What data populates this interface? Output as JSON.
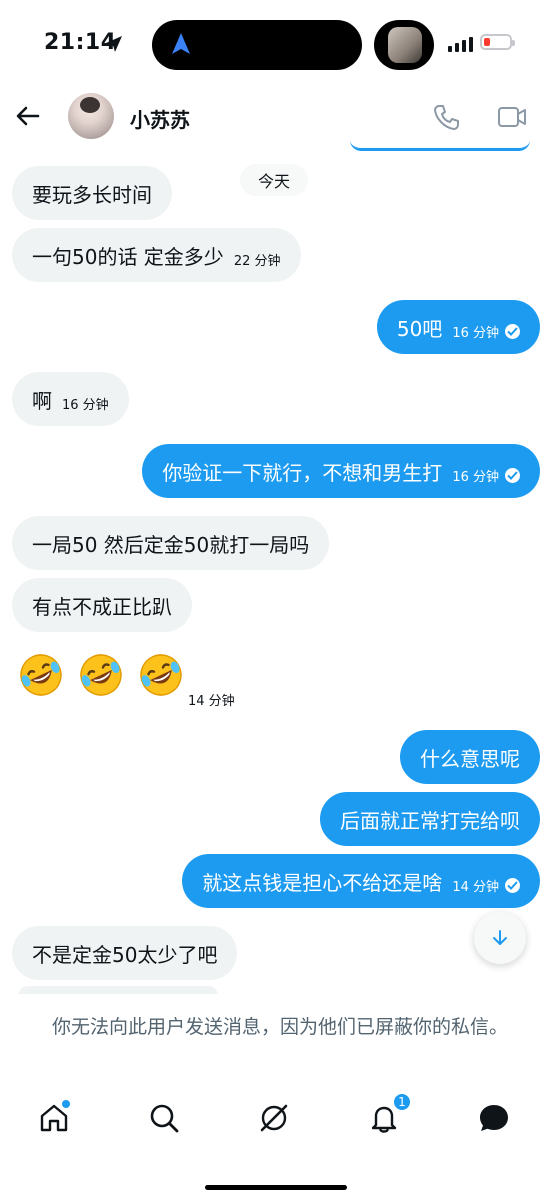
{
  "status_bar": {
    "time": "21:14"
  },
  "header": {
    "contact_name": "小苏苏"
  },
  "date_separator": "今天",
  "messages": [
    {
      "text": "要玩多长时间",
      "time": ""
    },
    {
      "text": "一句50的话 定金多少",
      "time": "22 分钟"
    },
    {
      "text": "50吧",
      "time": "16 分钟"
    },
    {
      "text": "啊",
      "time": "16 分钟"
    },
    {
      "text": "你验证一下就行，不想和男生打",
      "time": "16 分钟"
    },
    {
      "text": "一局50  然后定金50就打一局吗",
      "time": ""
    },
    {
      "text": "有点不成正比趴",
      "time": ""
    },
    {
      "text": "🤣🤣🤣",
      "time": "14 分钟"
    },
    {
      "text": "什么意思呢",
      "time": ""
    },
    {
      "text": "后面就正常打完给呗",
      "time": ""
    },
    {
      "text": "就这点钱是担心不给还是啥",
      "time": "14 分钟"
    },
    {
      "text": "不是定金50太少了吧",
      "time": ""
    }
  ],
  "blocked_notice": "你无法向此用户发送消息，因为他们已屏蔽你的私信。",
  "tabbar": {
    "notification_count": "1"
  },
  "colors": {
    "accent": "#1d9bf0",
    "bubble_received": "#eff3f4",
    "text_secondary": "#536471"
  }
}
